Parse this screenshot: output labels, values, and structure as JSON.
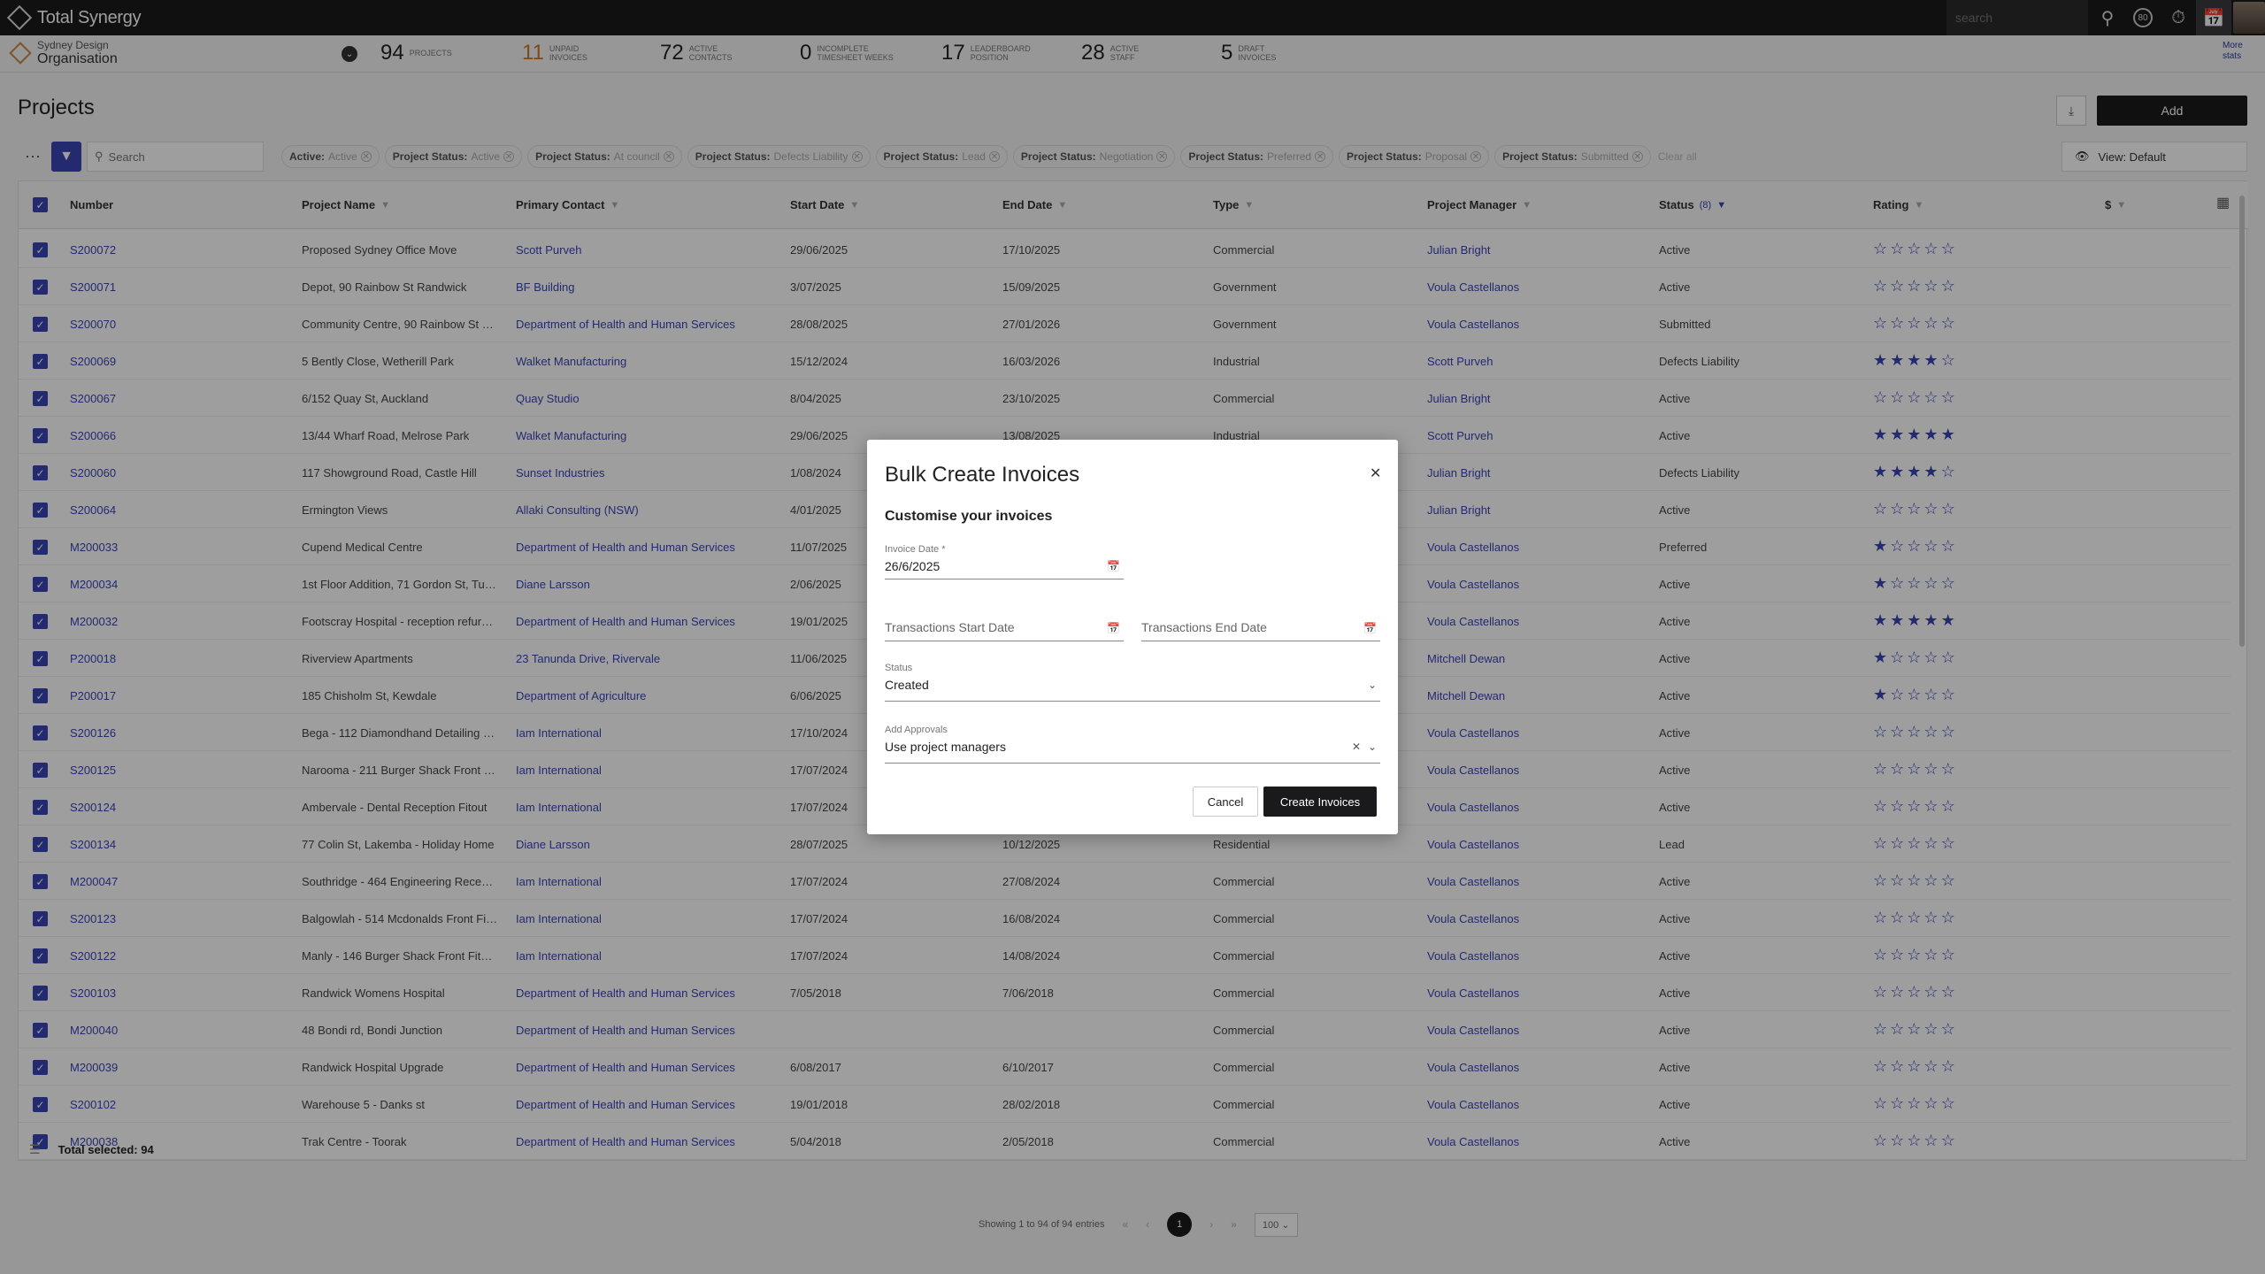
{
  "topbar": {
    "brand": "Total Synergy",
    "search_placeholder": "search",
    "badge": "80",
    "icons": [
      "search-icon",
      "badge-icon",
      "timer-icon",
      "calendar-icon",
      "avatar"
    ]
  },
  "org": {
    "sub": "Sydney Design",
    "name": "Organisation"
  },
  "stats": [
    {
      "value": "94",
      "label": "PROJECTS"
    },
    {
      "value": "11",
      "label": "UNPAID INVOICES"
    },
    {
      "value": "72",
      "label": "ACTIVE CONTACTS"
    },
    {
      "value": "0",
      "label": "INCOMPLETE TIMESHEET WEEKS"
    },
    {
      "value": "17",
      "label": "LEADERBOARD POSITION"
    },
    {
      "value": "28",
      "label": "ACTIVE STAFF"
    },
    {
      "value": "5",
      "label": "DRAFT INVOICES"
    }
  ],
  "more_stats": "More stats",
  "page": {
    "title": "Projects",
    "add_label": "Add",
    "search_placeholder": "Search",
    "view_label": "View: Default",
    "clear_all": "Clear all"
  },
  "chips": [
    {
      "key": "Active:",
      "value": "Active"
    },
    {
      "key": "Project Status:",
      "value": "Active"
    },
    {
      "key": "Project Status:",
      "value": "At council"
    },
    {
      "key": "Project Status:",
      "value": "Defects Liability"
    },
    {
      "key": "Project Status:",
      "value": "Lead"
    },
    {
      "key": "Project Status:",
      "value": "Negotiation"
    },
    {
      "key": "Project Status:",
      "value": "Preferred"
    },
    {
      "key": "Project Status:",
      "value": "Proposal"
    },
    {
      "key": "Project Status:",
      "value": "Submitted"
    }
  ],
  "columns": [
    "Number",
    "Project Name",
    "Primary Contact",
    "Start Date",
    "End Date",
    "Type",
    "Project Manager",
    "Status",
    "Rating",
    "$"
  ],
  "status_filter_count": "(8)",
  "rows": [
    [
      "S200072",
      "Proposed Sydney Office Move",
      "Scott Purveh",
      "29/06/2025",
      "17/10/2025",
      "Commercial",
      "Julian Bright",
      "Active",
      0
    ],
    [
      "S200071",
      "Depot, 90 Rainbow St Randwick",
      "BF Building",
      "3/07/2025",
      "15/09/2025",
      "Government",
      "Voula Castellanos",
      "Active",
      0
    ],
    [
      "S200070",
      "Community Centre, 90 Rainbow St Ra...",
      "Department of Health and Human Services",
      "28/08/2025",
      "27/01/2026",
      "Government",
      "Voula Castellanos",
      "Submitted",
      0
    ],
    [
      "S200069",
      "5 Bently Close, Wetherill Park",
      "Walket Manufacturing",
      "15/12/2024",
      "16/03/2026",
      "Industrial",
      "Scott Purveh",
      "Defects Liability",
      4
    ],
    [
      "S200067",
      "6/152 Quay St, Auckland",
      "Quay Studio",
      "8/04/2025",
      "23/10/2025",
      "Commercial",
      "Julian Bright",
      "Active",
      0
    ],
    [
      "S200066",
      "13/44 Wharf Road, Melrose Park",
      "Walket Manufacturing",
      "29/06/2025",
      "13/08/2025",
      "Industrial",
      "Scott Purveh",
      "Active",
      5
    ],
    [
      "S200060",
      "117 Showground Road, Castle Hill",
      "Sunset Industries",
      "1/08/2024",
      "",
      "",
      "Julian Bright",
      "Defects Liability",
      4
    ],
    [
      "S200064",
      "Ermington Views",
      "Allaki Consulting (NSW)",
      "4/01/2025",
      "",
      "",
      "Julian Bright",
      "Active",
      0
    ],
    [
      "M200033",
      "Cupend Medical Centre",
      "Department of Health and Human Services",
      "11/07/2025",
      "",
      "",
      "Voula Castellanos",
      "Preferred",
      1
    ],
    [
      "M200034",
      "1st Floor Addition, 71 Gordon St, Tulla...",
      "Diane Larsson",
      "2/06/2025",
      "",
      "",
      "Voula Castellanos",
      "Active",
      1
    ],
    [
      "M200032",
      "Footscray Hospital - reception refurbi...",
      "Department of Health and Human Services",
      "19/01/2025",
      "",
      "",
      "Voula Castellanos",
      "Active",
      5
    ],
    [
      "P200018",
      "Riverview Apartments",
      "23 Tanunda Drive, Rivervale",
      "11/06/2025",
      "",
      "",
      "Mitchell Dewan",
      "Active",
      1
    ],
    [
      "P200017",
      "185 Chisholm St, Kewdale",
      "Department of Agriculture",
      "6/06/2025",
      "",
      "",
      "Mitchell Dewan",
      "Active",
      1
    ],
    [
      "S200126",
      "Bega - 112 Diamondhand Detailing Re...",
      "Iam International",
      "17/10/2024",
      "",
      "",
      "Voula Castellanos",
      "Active",
      0
    ],
    [
      "S200125",
      "Narooma - 211 Burger Shack Front Fit...",
      "Iam International",
      "17/07/2024",
      "",
      "",
      "Voula Castellanos",
      "Active",
      0
    ],
    [
      "S200124",
      "Ambervale - Dental Reception Fitout",
      "Iam International",
      "17/07/2024",
      "",
      "",
      "Voula Castellanos",
      "Active",
      0
    ],
    [
      "S200134",
      "77 Colin St, Lakemba - Holiday Home",
      "Diane Larsson",
      "28/07/2025",
      "10/12/2025",
      "Residential",
      "Voula Castellanos",
      "Lead",
      0
    ],
    [
      "M200047",
      "Southridge - 464 Engineering Recepti...",
      "Iam International",
      "17/07/2024",
      "27/08/2024",
      "Commercial",
      "Voula Castellanos",
      "Active",
      0
    ],
    [
      "S200123",
      "Balgowlah - 514 Mcdonalds Front Fitout",
      "Iam International",
      "17/07/2024",
      "16/08/2024",
      "Commercial",
      "Voula Castellanos",
      "Active",
      0
    ],
    [
      "S200122",
      "Manly - 146 Burger Shack Front Fitout -",
      "Iam International",
      "17/07/2024",
      "14/08/2024",
      "Commercial",
      "Voula Castellanos",
      "Active",
      0
    ],
    [
      "S200103",
      "Randwick Womens Hospital",
      "Department of Health and Human Services",
      "7/05/2018",
      "7/06/2018",
      "Commercial",
      "Voula Castellanos",
      "Active",
      0
    ],
    [
      "M200040",
      "48 Bondi rd, Bondi Junction",
      "Department of Health and Human Services",
      "",
      "",
      "Commercial",
      "Voula Castellanos",
      "Active",
      0
    ],
    [
      "M200039",
      "Randwick Hospital Upgrade",
      "Department of Health and Human Services",
      "6/08/2017",
      "6/10/2017",
      "Commercial",
      "Voula Castellanos",
      "Active",
      0
    ],
    [
      "S200102",
      "Warehouse 5 - Danks st",
      "Department of Health and Human Services",
      "19/01/2018",
      "28/02/2018",
      "Commercial",
      "Voula Castellanos",
      "Active",
      0
    ],
    [
      "M200038",
      "Trak Centre - Toorak",
      "Department of Health and Human Services",
      "5/04/2018",
      "2/05/2018",
      "Commercial",
      "Voula Castellanos",
      "Active",
      0
    ]
  ],
  "footer": {
    "total_label": "Total selected:",
    "total_value": "94"
  },
  "pager": {
    "showing": "Showing 1 to 94 of 94 entries",
    "page": "1",
    "size": "100"
  },
  "modal": {
    "title": "Bulk Create Invoices",
    "subtitle": "Customise your invoices",
    "invoice_date_label": "Invoice Date *",
    "invoice_date_value": "26/6/2025",
    "start_date_placeholder": "Transactions Start Date",
    "end_date_placeholder": "Transactions End Date",
    "status_label": "Status",
    "status_value": "Created",
    "approvals_label": "Add Approvals",
    "approvals_value": "Use project managers",
    "cancel_label": "Cancel",
    "create_label": "Create Invoices"
  }
}
